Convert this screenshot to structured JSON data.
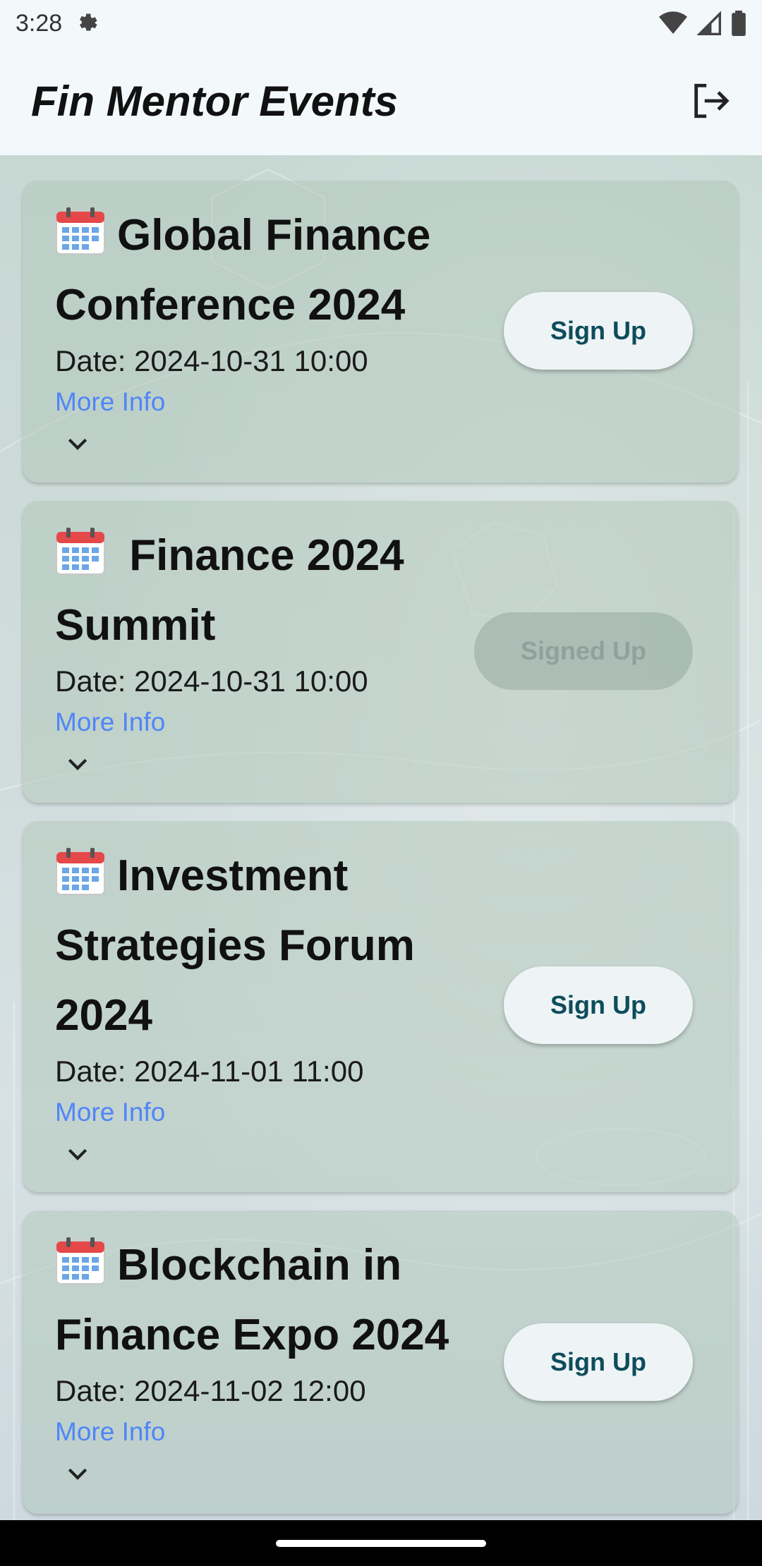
{
  "status_bar": {
    "time": "3:28"
  },
  "app_bar": {
    "title": "Fin Mentor Events"
  },
  "events": [
    {
      "title": "Global Finance Conference 2024",
      "date": "Date: 2024-10-31 10:00",
      "more_info": "More Info",
      "button": "Sign Up",
      "signed_up": false
    },
    {
      "title": " Finance 2024 Summit",
      "date": "Date: 2024-10-31 10:00",
      "more_info": "More Info",
      "button": "Signed Up",
      "signed_up": true
    },
    {
      "title": "Investment Strategies Forum 2024",
      "date": "Date: 2024-11-01 11:00",
      "more_info": "More Info",
      "button": "Sign Up",
      "signed_up": false
    },
    {
      "title": "Blockchain in Finance Expo 2024",
      "date": "Date: 2024-11-02 12:00",
      "more_info": "More Info",
      "button": "Sign Up",
      "signed_up": false
    }
  ],
  "colors": {
    "link": "#4f86f7",
    "button_text": "#0e4c5c",
    "card": "#b2c8bc"
  }
}
